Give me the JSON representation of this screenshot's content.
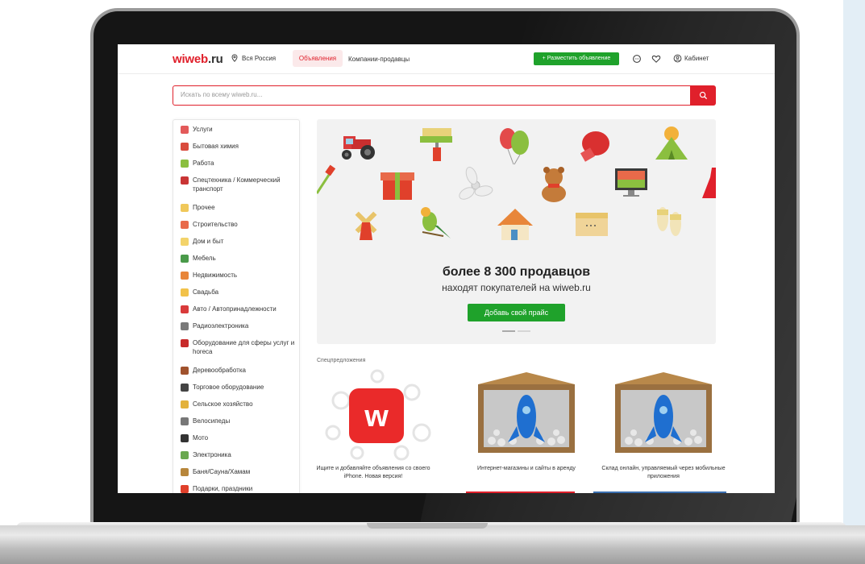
{
  "header": {
    "logo_main": "wiweb",
    "logo_tld": ".ru",
    "location": "Вся Россия",
    "nav": [
      "Объявления",
      "Компании-продавцы"
    ],
    "post_button": "+ Разместить объявление",
    "cabinet": "Кабинет"
  },
  "search": {
    "placeholder": "Искать по всему wiweb.ru..."
  },
  "categories": [
    {
      "label": "Услуги",
      "icon": "balloons-icon",
      "color": "#e35a5a"
    },
    {
      "label": "Бытовая химия",
      "icon": "spray-bottle-icon",
      "color": "#d94b3d"
    },
    {
      "label": "Работа",
      "icon": "shovel-icon",
      "color": "#8bbf3f"
    },
    {
      "label": "Спецтехника / Коммерческий транспорт",
      "icon": "tractor-icon",
      "color": "#c93535"
    },
    {
      "label": "Прочее",
      "icon": "box-icon",
      "color": "#f0c85a"
    },
    {
      "label": "Строительство",
      "icon": "paint-roller-icon",
      "color": "#e86a4a"
    },
    {
      "label": "Дом и быт",
      "icon": "slippers-icon",
      "color": "#f3d36a"
    },
    {
      "label": "Мебель",
      "icon": "sofa-icon",
      "color": "#4a9a4a"
    },
    {
      "label": "Недвижимость",
      "icon": "house-icon",
      "color": "#e8863a"
    },
    {
      "label": "Свадьба",
      "icon": "rings-icon",
      "color": "#f2c24a"
    },
    {
      "label": "Авто / Автопринадлежности",
      "icon": "steering-wheel-icon",
      "color": "#d93b3b"
    },
    {
      "label": "Радиоэлектроника",
      "icon": "soldering-iron-icon",
      "color": "#7a7a7a"
    },
    {
      "label": "Оборудование для сферы услуг и horeca",
      "icon": "chef-hat-icon",
      "color": "#c72b2b"
    },
    {
      "label": "Деревообработка",
      "icon": "plane-tool-icon",
      "color": "#a0522d"
    },
    {
      "label": "Торговое оборудование",
      "icon": "cash-register-icon",
      "color": "#444444"
    },
    {
      "label": "Сельское хозяйство",
      "icon": "wheat-icon",
      "color": "#e3b23c"
    },
    {
      "label": "Велосипеды",
      "icon": "bicycle-icon",
      "color": "#777777"
    },
    {
      "label": "Мото",
      "icon": "helmet-icon",
      "color": "#333333"
    },
    {
      "label": "Электроника",
      "icon": "monitor-icon",
      "color": "#6aa84f"
    },
    {
      "label": "Баня/Сауна/Хамам",
      "icon": "broom-icon",
      "color": "#b7863b"
    },
    {
      "label": "Подарки, праздники",
      "icon": "gift-icon",
      "color": "#e0402b"
    }
  ],
  "banner": {
    "title": "более 8 300 продавцов",
    "subtitle": "находят покупателей на wiweb.ru",
    "button": "Добавь свой прайс",
    "icons": [
      "tractor-icon",
      "paint-roller-icon",
      "balloons-icon",
      "boxing-glove-icon",
      "tent-icon",
      "shovel-icon",
      "gift-icon",
      "fan-icon",
      "teddy-bear-icon",
      "monitor-icon",
      "dress-icon",
      "windmill-icon",
      "parrot-icon",
      "house-icon",
      "box-icon",
      "slippers-icon"
    ]
  },
  "specials": {
    "title": "Спецпредложения",
    "cards": [
      {
        "caption": "Ищите и добавляйте объявления со своего iPhone. Новая версия!",
        "image": "wiweb-app-logo"
      },
      {
        "caption": "Интернет-магазины и сайты в аренду",
        "image": "rocket-box"
      },
      {
        "caption": "Склад онлайн, управляемый через мобильные приложения",
        "image": "rocket-box"
      }
    ]
  },
  "colors": {
    "brand": "#e0202b",
    "green": "#1fa22b"
  }
}
